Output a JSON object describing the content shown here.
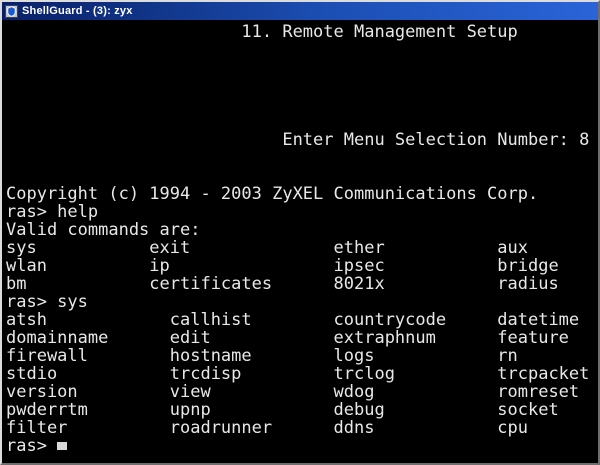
{
  "window": {
    "title": "ShellGuard - (3): zyx",
    "app_icon": "shellguard-app-icon",
    "title_bar_color_left": "#081f66",
    "title_bar_color_right": "#2a64d8",
    "title_text_color": "#ffffff"
  },
  "terminal": {
    "background_color": "#000000",
    "text_color": "#e8e8e8",
    "lines": [
      "                       11. Remote Management Setup",
      "",
      "",
      "",
      "",
      "",
      "                           Enter Menu Selection Number: 8",
      "",
      "",
      "Copyright (c) 1994 - 2003 ZyXEL Communications Corp.",
      "ras> help",
      "Valid commands are:",
      "sys           exit              ether           aux",
      "wlan          ip                ipsec           bridge",
      "bm            certificates      8021x           radius",
      "ras> sys",
      "atsh            callhist        countrycode     datetime",
      "domainname      edit            extraphnum      feature",
      "firewall        hostname        logs            rn",
      "stdio           trcdisp         trclog          trcpacket",
      "version         view            wdog            romreset",
      "pwderrtm        upnp            debug           socket",
      "filter          roadrunner      ddns            cpu"
    ],
    "prompt": "ras> "
  }
}
